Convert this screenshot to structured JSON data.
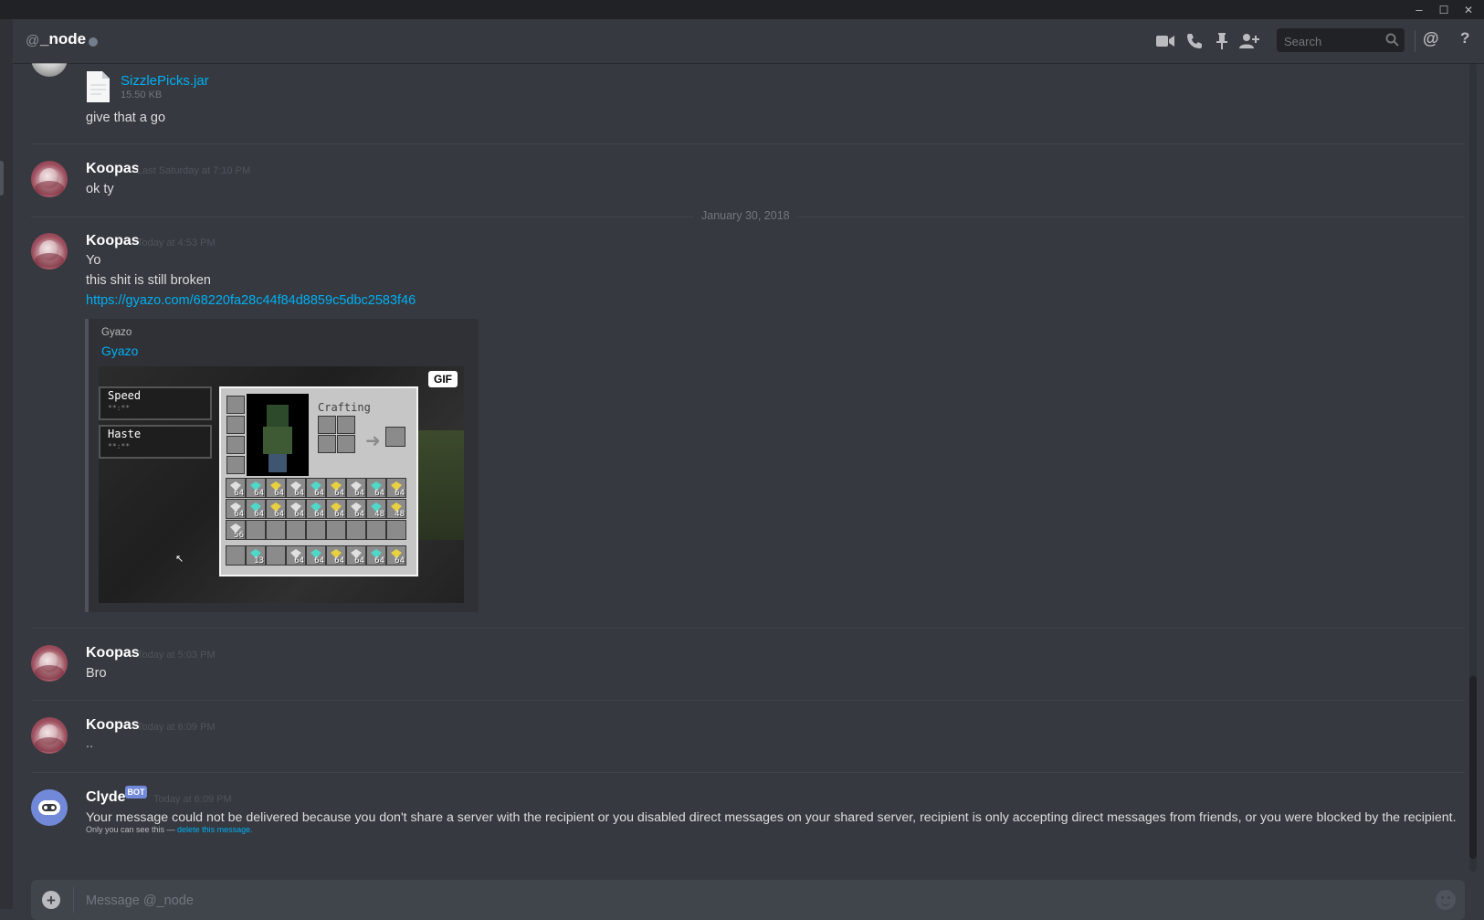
{
  "window": {
    "minimize_glyph": "–",
    "maximize_glyph": "☐",
    "close_glyph": "✕"
  },
  "header": {
    "at_symbol": "@",
    "channel_name": "_node",
    "status": "offline",
    "icons": [
      "video-call-icon",
      "voice-call-icon",
      "pin-icon",
      "add-friend-icon",
      "mention-icon",
      "help-icon"
    ],
    "search_placeholder": "Search",
    "mention_glyph": "@",
    "help_glyph": "?"
  },
  "messages": {
    "attachment": {
      "file_name": "SizzlePicks.jar",
      "file_size": "15.50 KB",
      "caption": "give that a go"
    },
    "m1": {
      "author": "Koopas",
      "timestamp": "Last Saturday at 7:10 PM",
      "lines": [
        "ok ty"
      ]
    },
    "date_separator": "January 30, 2018",
    "m2": {
      "author": "Koopas",
      "timestamp": "Today at 4:53 PM",
      "lines": [
        "Yo",
        "this shit is still broken"
      ],
      "link": "https://gyazo.com/68220fa28c44f84d8859c5dbc2583f46",
      "embed": {
        "provider": "Gyazo",
        "title": "Gyazo",
        "gif_badge": "GIF",
        "game": {
          "effects": [
            {
              "name": "Speed",
              "duration": "**:**"
            },
            {
              "name": "Haste",
              "duration": "**:**"
            }
          ],
          "crafting_label": "Crafting",
          "inventory_rows": [
            [
              "64",
              "64",
              "64",
              "64",
              "64",
              "64",
              "64",
              "64",
              "64"
            ],
            [
              "64",
              "64",
              "64",
              "64",
              "64",
              "64",
              "64",
              "48",
              "48"
            ],
            [
              "56",
              "",
              "",
              "",
              "",
              "",
              "",
              "",
              ""
            ],
            [
              "",
              "13",
              "",
              "64",
              "64",
              "64",
              "64",
              "64",
              "64"
            ]
          ]
        }
      }
    },
    "m3": {
      "author": "Koopas",
      "timestamp": "Today at 5:03 PM",
      "lines": [
        "Bro"
      ]
    },
    "m4": {
      "author": "Koopas",
      "timestamp": "Today at 6:09 PM",
      "lines": [
        ".."
      ]
    },
    "m5": {
      "author": "Clyde",
      "bot_badge": "BOT",
      "timestamp": "Today at 6:09 PM",
      "lines": [
        "Your message could not be delivered because you don't share a server with the recipient or you disabled direct messages on your shared server, recipient is only accepting direct messages from friends, or you were blocked by the recipient."
      ],
      "note_prefix": "Only you can see this — ",
      "note_link": "delete this message."
    }
  },
  "composer": {
    "placeholder": "Message @_node",
    "plus_glyph": "+"
  },
  "colors": {
    "background": "#36393f",
    "link": "#00b0f4",
    "bot_badge": "#7289da",
    "status_offline": "#747f8d"
  }
}
